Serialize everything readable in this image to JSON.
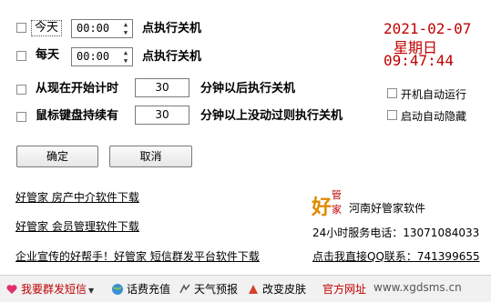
{
  "rows": {
    "today": {
      "label": "今天",
      "time": "00:00",
      "action": "点执行关机"
    },
    "everyday": {
      "label": "每天",
      "time": "00:00",
      "action": "点执行关机"
    },
    "countdown": {
      "label": "从现在开始计时",
      "minutes": "30",
      "suffix": "分钟以后执行关机"
    },
    "idle": {
      "label": "鼠标键盘持续有",
      "minutes": "30",
      "suffix": "分钟以上没动过则执行关机"
    }
  },
  "clock": {
    "date": "2021-02-07",
    "weekday": "星期日",
    "time": "09:47:44"
  },
  "options": {
    "autorun": "开机自动运行",
    "autohide": "启动自动隐藏"
  },
  "buttons": {
    "ok": "确定",
    "cancel": "取消"
  },
  "links": {
    "l1": "好管家 房产中介软件下载",
    "l2": "好管家 会员管理软件下载",
    "l3": "企业宣传的好帮手！好管家 短信群发平台软件下载"
  },
  "company": {
    "logo_chars": [
      "好",
      "管",
      "家"
    ],
    "name": "河南好管家软件",
    "phone": "24小时服务电话：13071084033",
    "qq": "点击我直接QQ联系：741399655"
  },
  "bottom": {
    "sms": "我要群发短信",
    "recharge": "话费充值",
    "weather": "天气预报",
    "skin": "改变皮肤",
    "site": "官方网址",
    "url": "www.xgdsms.cn"
  }
}
